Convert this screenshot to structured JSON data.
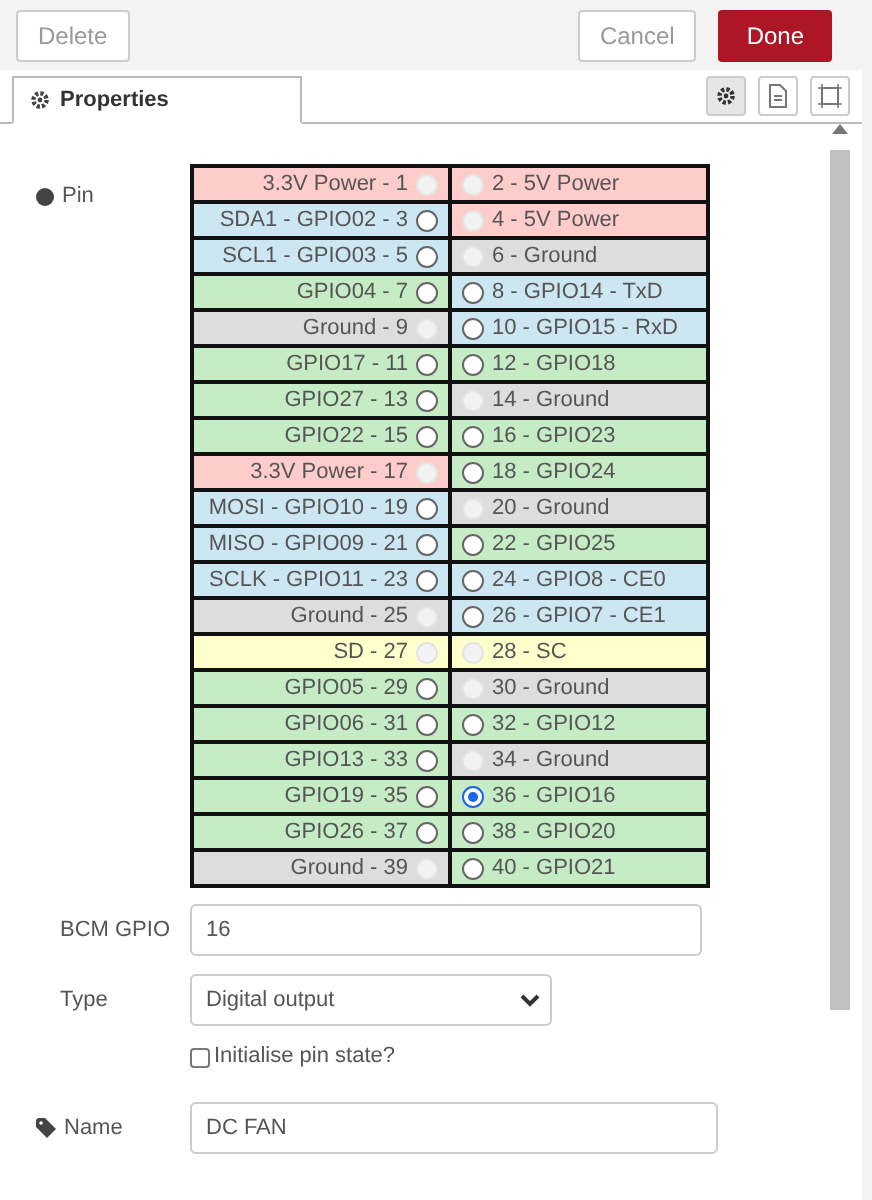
{
  "actions": {
    "delete": "Delete",
    "cancel": "Cancel",
    "done": "Done"
  },
  "tabs": [
    {
      "label": "Properties",
      "selected": true
    }
  ],
  "tab_tools": [
    {
      "kind": "settings",
      "selected": true
    },
    {
      "kind": "description",
      "selected": false
    },
    {
      "kind": "appearance",
      "selected": false
    }
  ],
  "pin_label": "Pin",
  "pins": [
    {
      "label": "3.3V Power - 1",
      "color": "#ffcccc",
      "disabled": true,
      "selected": false
    },
    {
      "label": "2 - 5V Power",
      "color": "#ffcccc",
      "disabled": true,
      "selected": false
    },
    {
      "label": "SDA1 - GPIO02 - 3",
      "color": "#cce6f2",
      "disabled": false,
      "selected": false
    },
    {
      "label": "4 - 5V Power",
      "color": "#ffcccc",
      "disabled": true,
      "selected": false
    },
    {
      "label": "SCL1 - GPIO03 - 5",
      "color": "#cce6f2",
      "disabled": false,
      "selected": false
    },
    {
      "label": "6 - Ground",
      "color": "#dddddd",
      "disabled": true,
      "selected": false
    },
    {
      "label": "GPIO04 - 7",
      "color": "#c6ecc6",
      "disabled": false,
      "selected": false
    },
    {
      "label": "8 - GPIO14 - TxD",
      "color": "#cce6f2",
      "disabled": false,
      "selected": false
    },
    {
      "label": "Ground - 9",
      "color": "#dddddd",
      "disabled": true,
      "selected": false
    },
    {
      "label": "10 - GPIO15 - RxD",
      "color": "#cce6f2",
      "disabled": false,
      "selected": false
    },
    {
      "label": "GPIO17 - 11",
      "color": "#c6ecc6",
      "disabled": false,
      "selected": false
    },
    {
      "label": "12 - GPIO18",
      "color": "#c6ecc6",
      "disabled": false,
      "selected": false
    },
    {
      "label": "GPIO27 - 13",
      "color": "#c6ecc6",
      "disabled": false,
      "selected": false
    },
    {
      "label": "14 - Ground",
      "color": "#dddddd",
      "disabled": true,
      "selected": false
    },
    {
      "label": "GPIO22 - 15",
      "color": "#c6ecc6",
      "disabled": false,
      "selected": false
    },
    {
      "label": "16 - GPIO23",
      "color": "#c6ecc6",
      "disabled": false,
      "selected": false
    },
    {
      "label": "3.3V Power - 17",
      "color": "#ffcccc",
      "disabled": true,
      "selected": false
    },
    {
      "label": "18 - GPIO24",
      "color": "#c6ecc6",
      "disabled": false,
      "selected": false
    },
    {
      "label": "MOSI - GPIO10 - 19",
      "color": "#cce6f2",
      "disabled": false,
      "selected": false
    },
    {
      "label": "20 - Ground",
      "color": "#dddddd",
      "disabled": true,
      "selected": false
    },
    {
      "label": "MISO - GPIO09 - 21",
      "color": "#cce6f2",
      "disabled": false,
      "selected": false
    },
    {
      "label": "22 - GPIO25",
      "color": "#c6ecc6",
      "disabled": false,
      "selected": false
    },
    {
      "label": "SCLK - GPIO11 - 23",
      "color": "#cce6f2",
      "disabled": false,
      "selected": false
    },
    {
      "label": "24 - GPIO8 - CE0",
      "color": "#cce6f2",
      "disabled": false,
      "selected": false
    },
    {
      "label": "Ground - 25",
      "color": "#dddddd",
      "disabled": true,
      "selected": false
    },
    {
      "label": "26 - GPIO7 - CE1",
      "color": "#cce6f2",
      "disabled": false,
      "selected": false
    },
    {
      "label": "SD - 27",
      "color": "#ffffcc",
      "disabled": true,
      "selected": false
    },
    {
      "label": "28 - SC",
      "color": "#ffffcc",
      "disabled": true,
      "selected": false
    },
    {
      "label": "GPIO05 - 29",
      "color": "#c6ecc6",
      "disabled": false,
      "selected": false
    },
    {
      "label": "30 - Ground",
      "color": "#dddddd",
      "disabled": true,
      "selected": false
    },
    {
      "label": "GPIO06 - 31",
      "color": "#c6ecc6",
      "disabled": false,
      "selected": false
    },
    {
      "label": "32 - GPIO12",
      "color": "#c6ecc6",
      "disabled": false,
      "selected": false
    },
    {
      "label": "GPIO13 - 33",
      "color": "#c6ecc6",
      "disabled": false,
      "selected": false
    },
    {
      "label": "34 - Ground",
      "color": "#dddddd",
      "disabled": true,
      "selected": false
    },
    {
      "label": "GPIO19 - 35",
      "color": "#c6ecc6",
      "disabled": false,
      "selected": false
    },
    {
      "label": "36 - GPIO16",
      "color": "#c6ecc6",
      "disabled": false,
      "selected": true
    },
    {
      "label": "GPIO26 - 37",
      "color": "#c6ecc6",
      "disabled": false,
      "selected": false
    },
    {
      "label": "38 - GPIO20",
      "color": "#c6ecc6",
      "disabled": false,
      "selected": false
    },
    {
      "label": "Ground - 39",
      "color": "#dddddd",
      "disabled": true,
      "selected": false
    },
    {
      "label": "40 - GPIO21",
      "color": "#c6ecc6",
      "disabled": false,
      "selected": false
    }
  ],
  "bcm_gpio": {
    "label": "BCM GPIO",
    "value": "16"
  },
  "type": {
    "label": "Type",
    "value": "Digital output"
  },
  "init_state": {
    "label": "Initialise pin state?",
    "checked": false
  },
  "name": {
    "label": "Name",
    "value": "DC FAN"
  }
}
